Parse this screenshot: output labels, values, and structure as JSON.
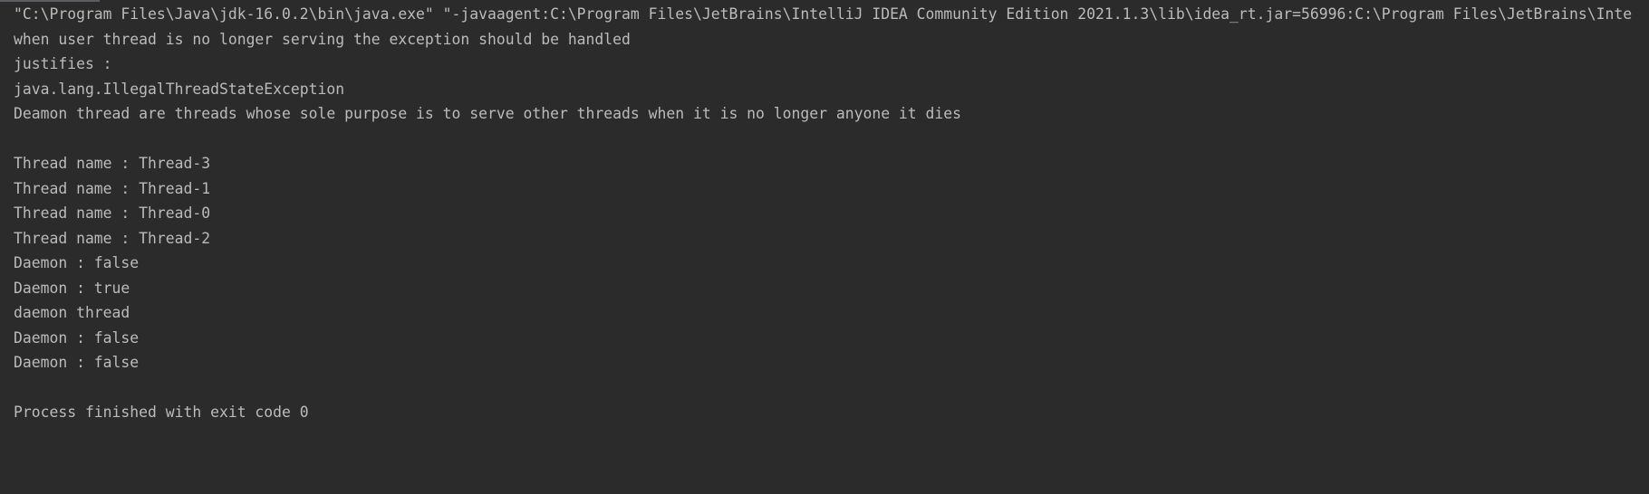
{
  "console": {
    "lines": [
      "\"C:\\Program Files\\Java\\jdk-16.0.2\\bin\\java.exe\" \"-javaagent:C:\\Program Files\\JetBrains\\IntelliJ IDEA Community Edition 2021.1.3\\lib\\idea_rt.jar=56996:C:\\Program Files\\JetBrains\\Inte",
      "when user thread is no longer serving the exception should be handled",
      "justifies :",
      "java.lang.IllegalThreadStateException",
      "Deamon thread are threads whose sole purpose is to serve other threads when it is no longer anyone it dies",
      "",
      "Thread name : Thread-3",
      "Thread name : Thread-1",
      "Thread name : Thread-0",
      "Thread name : Thread-2",
      "Daemon : false",
      "Daemon : true",
      "daemon thread",
      "Daemon : false",
      "Daemon : false",
      "",
      "Process finished with exit code 0"
    ]
  },
  "colors": {
    "background": "#2b2b2b",
    "text": "#bbbbbb"
  }
}
